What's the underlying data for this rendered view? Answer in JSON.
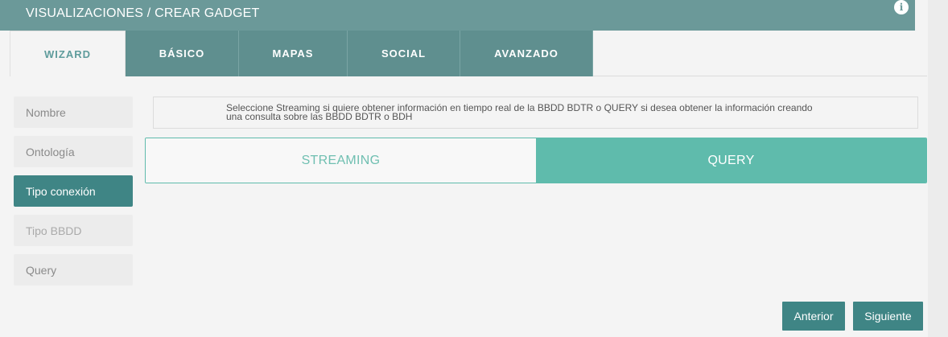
{
  "header": {
    "title": "VISUALIZACIONES / CREAR GADGET",
    "info_icon": "info-icon"
  },
  "tabs": [
    {
      "label": "WIZARD",
      "active": true
    },
    {
      "label": "BÁSICO",
      "active": false
    },
    {
      "label": "MAPAS",
      "active": false
    },
    {
      "label": "SOCIAL",
      "active": false
    },
    {
      "label": "AVANZADO",
      "active": false
    }
  ],
  "steps": [
    {
      "label": "Nombre",
      "state": "inactive"
    },
    {
      "label": "Ontología",
      "state": "inactive"
    },
    {
      "label": "Tipo conexión",
      "state": "active"
    },
    {
      "label": "Tipo BBDD",
      "state": "disabled"
    },
    {
      "label": "Query",
      "state": "inactive"
    }
  ],
  "help": {
    "line1": "Seleccione Streaming si quiere obtener información en tiempo real de la BBDD BDTR o QUERY si desea obtener la información creando",
    "line2": "una consulta sobre las BBDD BDTR o BDH"
  },
  "connection_toggle": {
    "options": [
      "STREAMING",
      "QUERY"
    ],
    "selected": "QUERY"
  },
  "actions": {
    "previous": "Anterior",
    "next": "Siguiente"
  },
  "colors": {
    "header": "#6b9999",
    "accent": "#3f8585",
    "toggle": "#5fbbac"
  }
}
